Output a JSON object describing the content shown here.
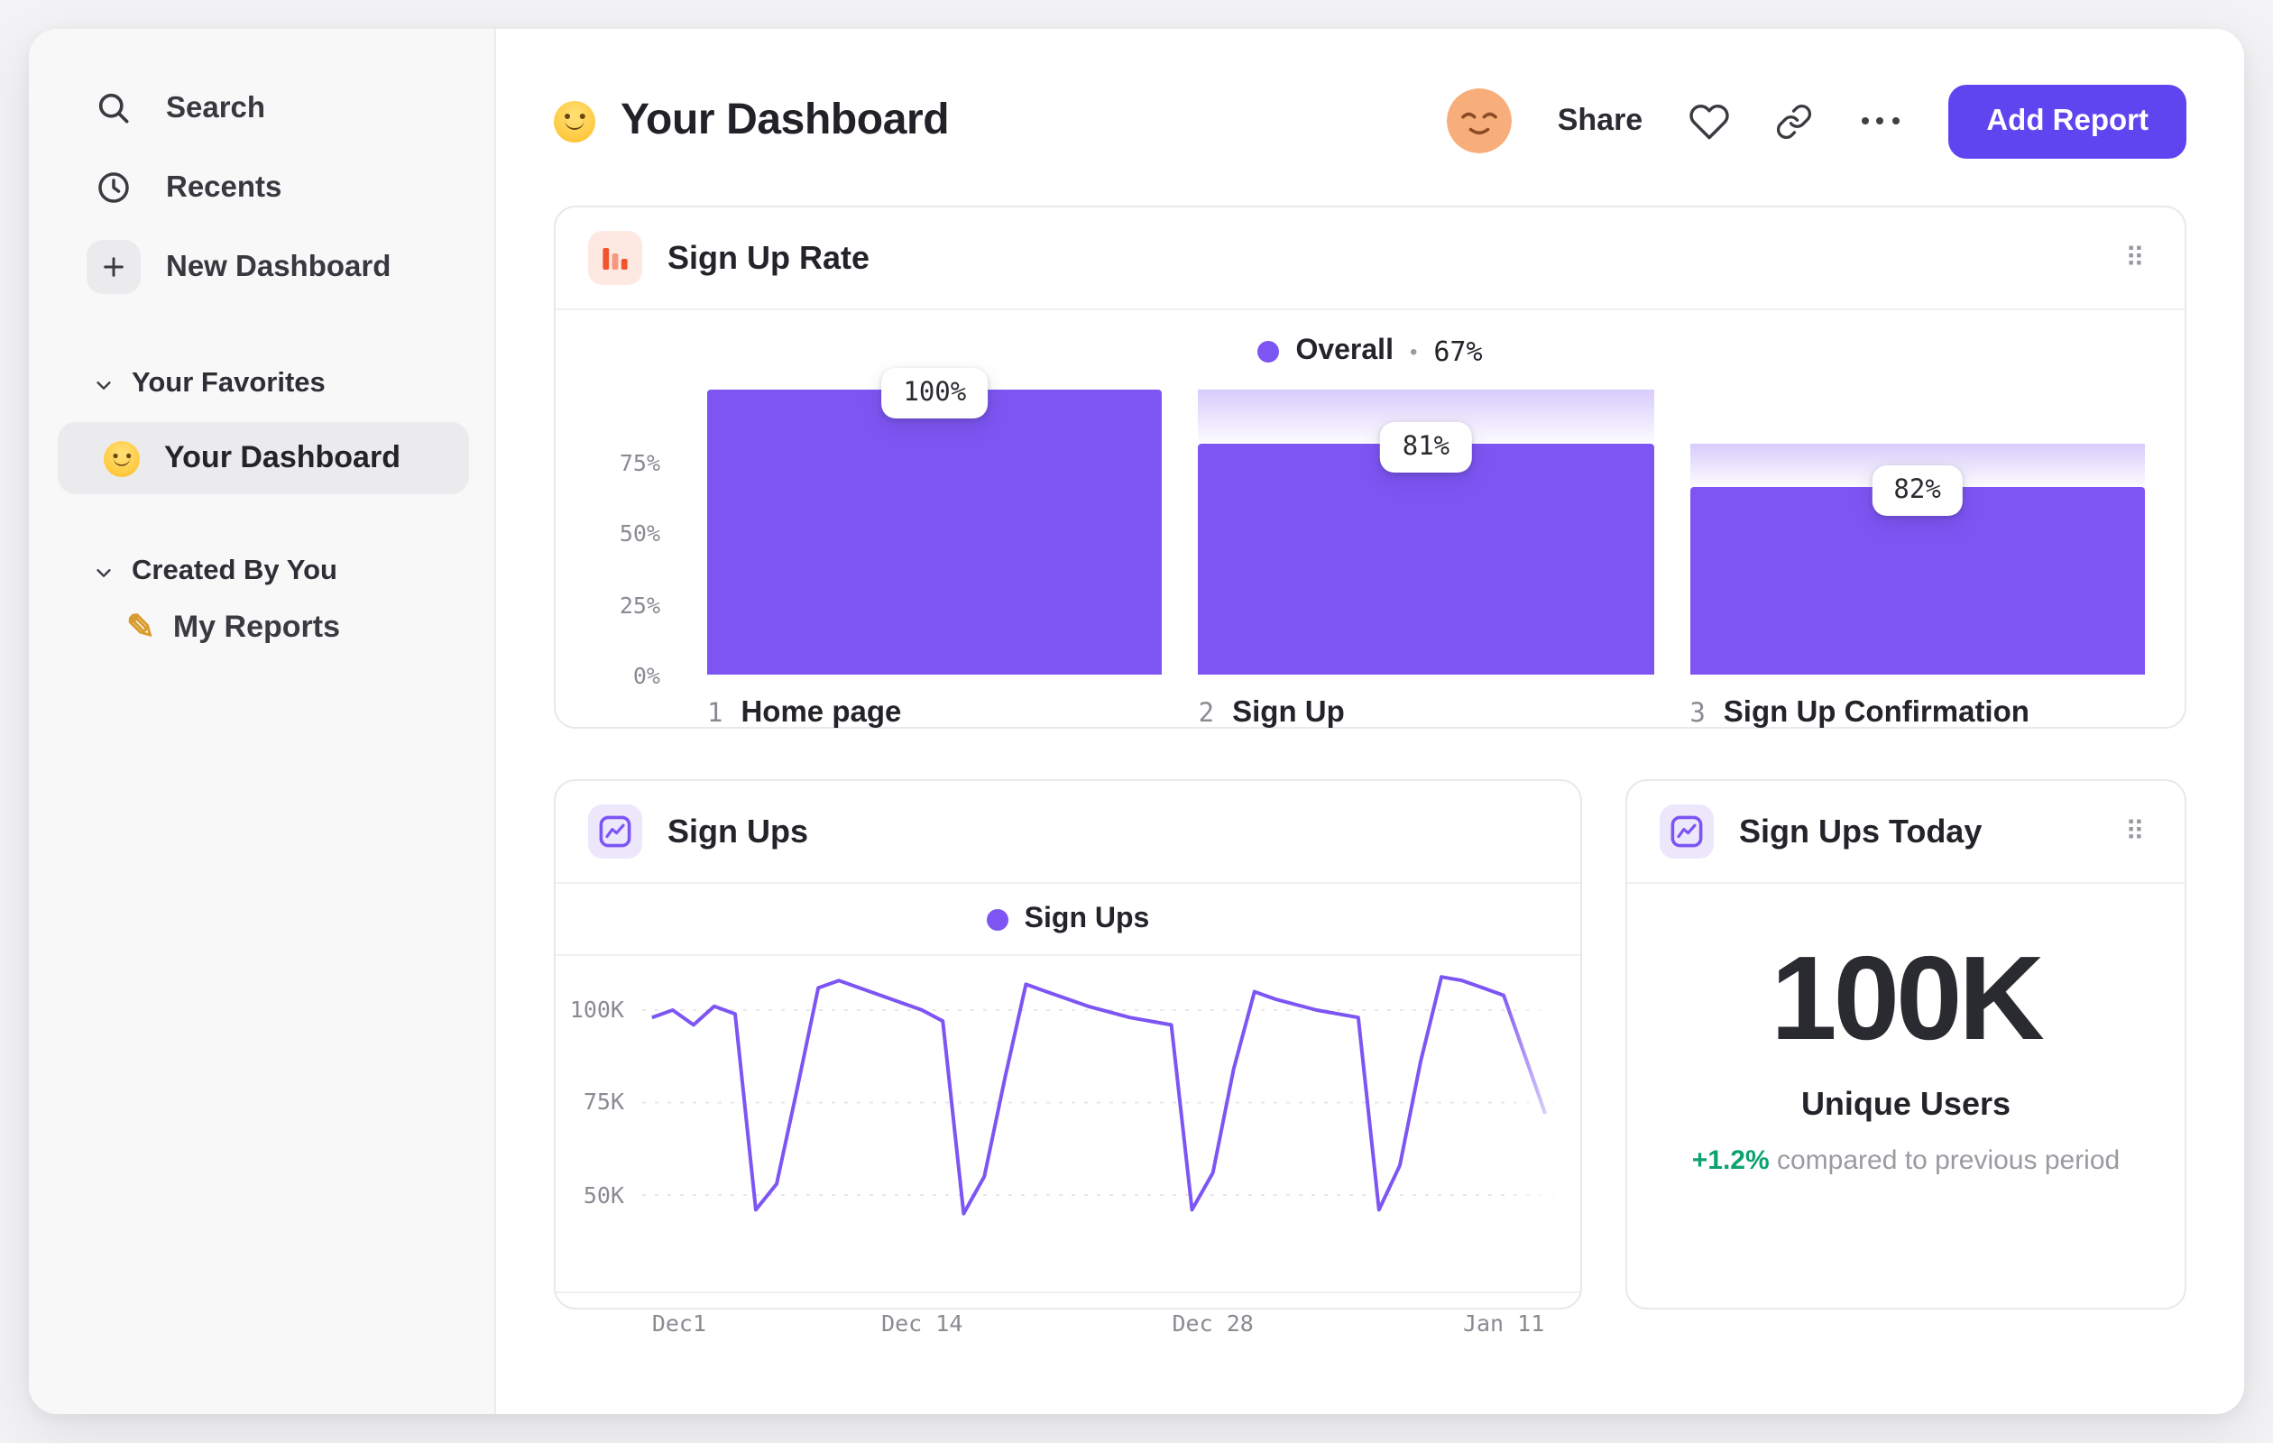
{
  "sidebar": {
    "nav": [
      {
        "label": "Search",
        "icon": "search-icon"
      },
      {
        "label": "Recents",
        "icon": "clock-icon"
      },
      {
        "label": "New Dashboard",
        "icon": "plus-icon"
      }
    ],
    "sections": [
      {
        "title": "Your Favorites",
        "items": [
          {
            "label": "Your Dashboard",
            "icon": "smiley-face-icon",
            "selected": true
          }
        ]
      },
      {
        "title": "Created By You",
        "items": [
          {
            "label": "My Reports",
            "icon": "pencil-icon",
            "selected": false
          }
        ]
      }
    ]
  },
  "header": {
    "title": "Your Dashboard",
    "title_icon": "smiley-face-icon",
    "avatar_icon": "relieved-face-avatar",
    "share_label": "Share",
    "add_report_label": "Add Report"
  },
  "today": {
    "title": "Sign Ups Today",
    "value": "100K",
    "subtitle": "Unique Users",
    "delta": "+1.2%",
    "delta_note": "compared to previous period"
  },
  "glyphs": {
    "drag_handle": "⠿",
    "pencil": "✎"
  },
  "colors": {
    "accent_purple": "#7D55F3",
    "button_purple": "#5F45F0",
    "orange": "#F2552C",
    "green": "#0CA36E"
  },
  "chart_data": [
    {
      "type": "bar",
      "subtype": "funnel",
      "title": "Sign Up Rate",
      "legend": {
        "series": "Overall",
        "separator": "•",
        "value_label": "67%",
        "value_pct": 67
      },
      "y_axis": {
        "unit": "%",
        "ticks": [
          75,
          50,
          25,
          0
        ],
        "tick_labels": [
          "75%",
          "50%",
          "25%",
          "0%"
        ],
        "range": [
          0,
          100
        ]
      },
      "steps": [
        {
          "step_label": "1",
          "label": "Home page",
          "conversion_label": "100%",
          "conversion_from_previous_pct": 100,
          "overall_pct": 100,
          "prev_overall_pct": 100
        },
        {
          "step_label": "2",
          "label": "Sign Up",
          "conversion_label": "81%",
          "conversion_from_previous_pct": 81,
          "overall_pct": 81,
          "prev_overall_pct": 100
        },
        {
          "step_label": "3",
          "label": "Sign Up Confirmation",
          "conversion_label": "82%",
          "conversion_from_previous_pct": 82,
          "overall_pct": 66,
          "prev_overall_pct": 81
        }
      ],
      "bar_color": "#7D55F3",
      "grid": false,
      "legend_position": "top-center"
    },
    {
      "type": "line",
      "title": "Sign Ups",
      "legend_label": "Sign Ups",
      "line_color": "#7D55F3",
      "grid": "dashed-horizontal",
      "legend_position": "top-center",
      "y_axis": {
        "unit": "K",
        "ticks_k": [
          100,
          75,
          50
        ],
        "labels": [
          "100K",
          "75K",
          "50K"
        ],
        "range_k": [
          40,
          112
        ]
      },
      "x_axis": {
        "domain_days": [
          0,
          43
        ],
        "ticks": [
          {
            "label": "Dec1",
            "day": 0
          },
          {
            "label": "Dec 14",
            "day": 13
          },
          {
            "label": "Dec 28",
            "day": 27
          },
          {
            "label": "Jan 11",
            "day": 41
          }
        ]
      },
      "series": [
        {
          "name": "Sign Ups",
          "unit": "K",
          "points": [
            [
              0,
              98
            ],
            [
              1,
              100
            ],
            [
              2,
              96
            ],
            [
              3,
              101
            ],
            [
              4,
              99
            ],
            [
              5,
              46
            ],
            [
              6,
              53
            ],
            [
              7,
              79
            ],
            [
              8,
              106
            ],
            [
              9,
              108
            ],
            [
              11,
              104
            ],
            [
              13,
              100
            ],
            [
              14,
              97
            ],
            [
              15,
              45
            ],
            [
              16,
              55
            ],
            [
              17,
              82
            ],
            [
              18,
              107
            ],
            [
              19,
              105
            ],
            [
              21,
              101
            ],
            [
              23,
              98
            ],
            [
              25,
              96
            ],
            [
              26,
              46
            ],
            [
              27,
              56
            ],
            [
              28,
              84
            ],
            [
              29,
              105
            ],
            [
              30,
              103
            ],
            [
              32,
              100
            ],
            [
              34,
              98
            ],
            [
              35,
              46
            ],
            [
              36,
              58
            ],
            [
              37,
              86
            ],
            [
              38,
              109
            ],
            [
              39,
              108
            ],
            [
              40,
              106
            ],
            [
              41,
              104
            ],
            [
              42,
              88
            ],
            [
              43,
              72
            ]
          ]
        }
      ]
    }
  ]
}
